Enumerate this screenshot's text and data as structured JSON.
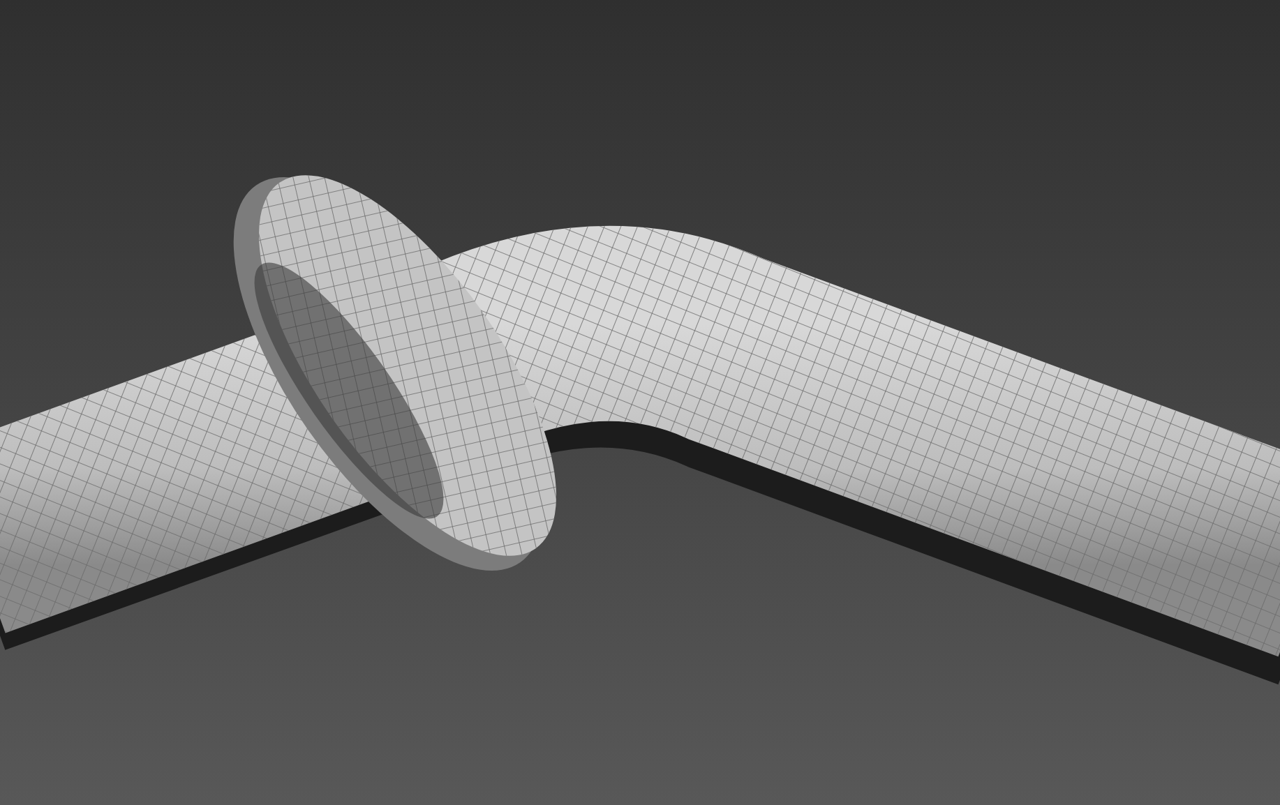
{
  "viewport": {
    "kind": "mesh-render"
  }
}
